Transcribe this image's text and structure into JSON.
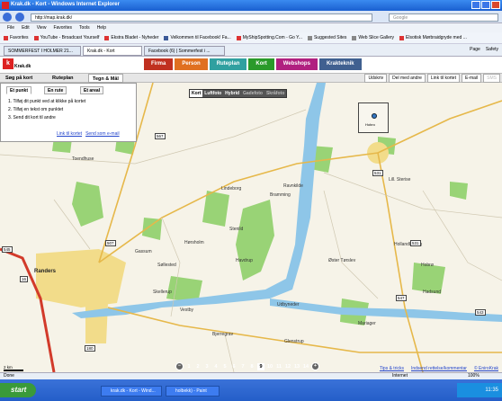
{
  "window": {
    "title": "Krak.dk - Kort - Windows Internet Explorer"
  },
  "browser": {
    "url": "http://map.krak.dk/",
    "search_placeholder": "Google",
    "menu": [
      "File",
      "Edit",
      "View",
      "Favorites",
      "Tools",
      "Help"
    ],
    "favorites_label": "Favorites",
    "favorites": [
      "YouTube - Broadcast Yourself",
      "Ekstra Bladet - Nyheder",
      "Velkommen til Facebook! Fa...",
      "MyShipSpotting.Com - Go Y...",
      "Suggested Sites",
      "Web Slice Gallery",
      "Elsotisk Mørbraidgryde med ..."
    ],
    "tabs": [
      "SOMMERFEST I HOLMER 21...",
      "Krak.dk - Kort",
      "Facebook (6) | Sommerfest i ..."
    ],
    "toolbar_right": [
      "Page",
      "Safety"
    ]
  },
  "site": {
    "logo_letter": "k",
    "logo_name": "Krak.dk",
    "categories": [
      "Firma",
      "Person",
      "Ruteplan",
      "Kort",
      "Webshops",
      "Krakteknik"
    ],
    "menus": [
      "Søg på kort",
      "Ruteplan",
      "Tegn & Mål"
    ],
    "actions": [
      "Udskriv",
      "Del med andre",
      "Link til kortet",
      "E-mail",
      "SMS"
    ]
  },
  "panel": {
    "tabs": [
      "Et punkt",
      "En rute",
      "Et areal"
    ],
    "steps": [
      "1. Tilføj dit punkt ved at klikke på kortet",
      "2. Tilføj en tekst om punktet",
      "3. Send dit kort til andre"
    ],
    "links": [
      "Link til kortet",
      "Send som e-mail"
    ]
  },
  "map": {
    "types": [
      "Kort",
      "Luftfoto",
      "Hybrid",
      "Gadefoto",
      "Skråfoto"
    ],
    "pin_label": "Hobro",
    "places": [
      "Randers",
      "Hobro",
      "Toendhuse",
      "Lindeborg",
      "Stenild",
      "Hørsholm",
      "Ravnkilde",
      "Gassum",
      "Øster Tørslev",
      "Lill. Sterise",
      "Hobrø",
      "Hollandbaring",
      "Bramming",
      "Udbyneder",
      "Havdrup",
      "Mariager",
      "Vestby",
      "Hadsund",
      "Skellerup",
      "Glenstrup",
      "Bjerregrav",
      "Søllested"
    ],
    "road_numbers": [
      "567",
      "507",
      "531",
      "531",
      "16",
      "547",
      "180",
      "545",
      "543"
    ],
    "zoom_levels": [
      "1",
      "2",
      "3",
      "4",
      "5",
      "6",
      "7",
      "8",
      "9",
      "10",
      "11",
      "12",
      "13",
      "14"
    ],
    "zoom_current": "9",
    "scale_label": "2 km",
    "footer_links": [
      "Tips & tricks",
      "Indsend rettelse/kommentar",
      "© EniroKrak"
    ]
  },
  "status": {
    "left": "Done",
    "zone": "Internet",
    "zoom": "100%"
  },
  "taskbar": {
    "start": "start",
    "tasks": [
      "krak.dk - Kort - Wind...",
      "holbekk) - Paint"
    ],
    "clock": "11:35"
  }
}
